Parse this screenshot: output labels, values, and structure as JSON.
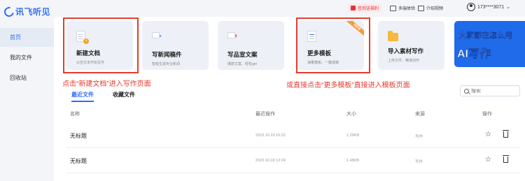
{
  "app": {
    "logo_text": "讯飞听见"
  },
  "sidebar": {
    "items": [
      {
        "label": "首页",
        "active": true
      },
      {
        "label": "我的文件",
        "active": false
      },
      {
        "label": "回收站",
        "active": false
      }
    ]
  },
  "header": {
    "promo": "签到送福利",
    "experience": "多端体验",
    "video_intro": "介绍视频",
    "user": "173****3071"
  },
  "cards": [
    {
      "title": "新建文档",
      "subtitle": "从空文本开始写作",
      "icon": "document-icon"
    },
    {
      "title": "写新闻稿件",
      "subtitle": "智能生成专业新闻",
      "icon": "news-icon",
      "tag": "NEWS"
    },
    {
      "title": "写品宣文案",
      "subtitle": "爆款文案、轻松get",
      "icon": "xiaohongshu-icon",
      "tag": "小红书"
    },
    {
      "title": "更多模板",
      "subtitle": "海量模板、一键成稿",
      "icon": "template-icon",
      "ribbon": "NEW"
    },
    {
      "title": "导入素材写作",
      "subtitle": "上传文件、精准创作",
      "icon": "folder-icon"
    }
  ],
  "banner": {
    "line1": "大家都在怎么用",
    "line2": "AI写作"
  },
  "annotations": {
    "left": "点击“新建文档”进入写作页面",
    "right": "或直接点击“更多模板”直接进入模板页面"
  },
  "tabs": [
    {
      "label": "最近文件",
      "active": true
    },
    {
      "label": "收藏文件",
      "active": false
    }
  ],
  "search": {
    "placeholder": "搜索"
  },
  "table": {
    "headers": {
      "name": "名称",
      "recent": "最近操作",
      "size": "大小",
      "source": "来源",
      "actions": "操作"
    },
    "rows": [
      {
        "name": "无标题",
        "time": "2023.10.19 15:22",
        "size": "1.29KB",
        "source": "写作"
      },
      {
        "name": "无标题",
        "time": "2023.10.18 12:24",
        "size": "1.48KB",
        "source": "写作"
      }
    ]
  },
  "colors": {
    "accent": "#2f6df6",
    "annotation": "#e63b2e",
    "banner": "#1f6bea"
  }
}
